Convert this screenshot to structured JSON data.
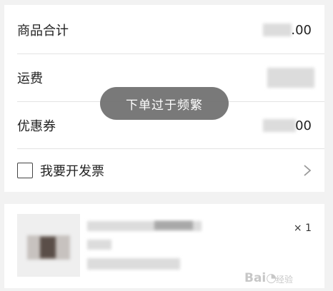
{
  "summary": {
    "subtotal_label": "商品合计",
    "subtotal_value_suffix": ".00",
    "shipping_label": "运费",
    "coupon_label": "优惠券",
    "coupon_value_suffix": "00",
    "invoice_label": "我要开发票"
  },
  "toast": {
    "message": "下单过于频繁"
  },
  "product": {
    "quantity": "× 1"
  },
  "icons": {
    "checkbox": "checkbox-icon",
    "chevron": "chevron-right-icon"
  },
  "colors": {
    "toast_bg": "#6e6e6e",
    "page_bg": "#f2f2f2",
    "card_bg": "#ffffff"
  }
}
